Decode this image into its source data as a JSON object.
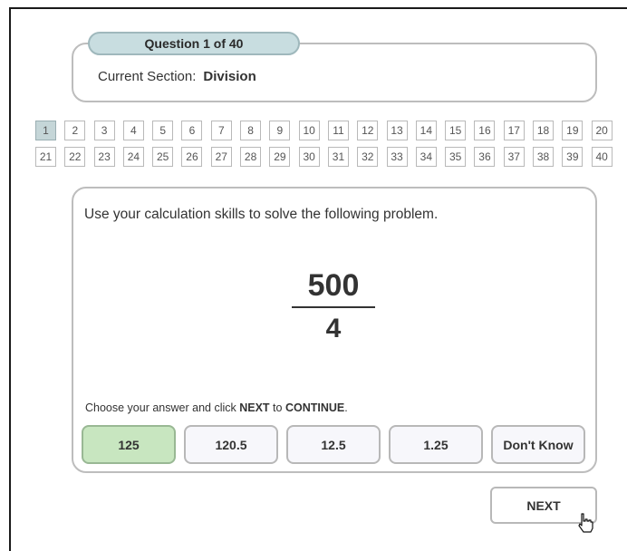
{
  "header": {
    "question_label": "Question 1 of 40",
    "section_label": "Current Section:",
    "section_value": "Division"
  },
  "question_numbers": {
    "current": 1,
    "row1": [
      "1",
      "2",
      "3",
      "4",
      "5",
      "6",
      "7",
      "8",
      "9",
      "10",
      "11",
      "12",
      "13",
      "14",
      "15",
      "16",
      "17",
      "18",
      "19",
      "20"
    ],
    "row2": [
      "21",
      "22",
      "23",
      "24",
      "25",
      "26",
      "27",
      "28",
      "29",
      "30",
      "31",
      "32",
      "33",
      "34",
      "35",
      "36",
      "37",
      "38",
      "39",
      "40"
    ]
  },
  "question": {
    "instruction": "Use your calculation skills to solve the following problem.",
    "numerator": "500",
    "denominator": "4"
  },
  "answer_prompt": {
    "part1": "Choose your answer and click ",
    "next_word": "NEXT",
    "part2": " to ",
    "continue_word": "CONTINUE",
    "part3": "."
  },
  "answers": [
    {
      "label": "125",
      "selected": true
    },
    {
      "label": "120.5",
      "selected": false
    },
    {
      "label": "12.5",
      "selected": false
    },
    {
      "label": "1.25",
      "selected": false
    },
    {
      "label": "Don't Know",
      "selected": false
    }
  ],
  "footer": {
    "next_label": "NEXT"
  },
  "colors": {
    "selected_answer": "#c8e6c0",
    "current_question": "#c5d6d8",
    "pill": "#c8dde0"
  },
  "icons": {
    "cursor": "hand-pointer-icon"
  }
}
